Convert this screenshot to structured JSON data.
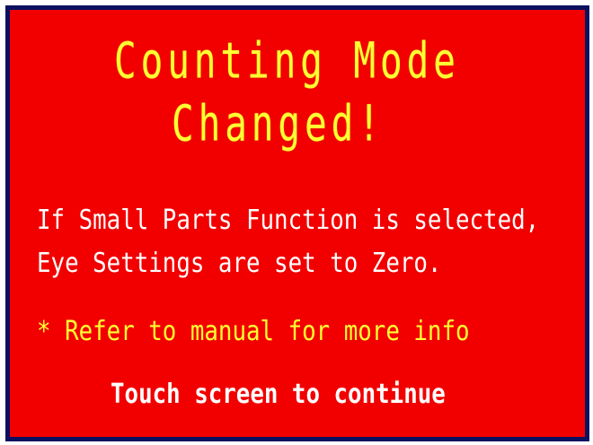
{
  "dialog": {
    "title_line1": "Counting Mode",
    "title_line2": "Changed!",
    "message_line1": "If Small Parts Function is selected,",
    "message_line2": "Eye Settings are set to Zero.",
    "note": "* Refer to manual for more info",
    "prompt": "Touch screen to continue"
  },
  "colors": {
    "background": "#f20000",
    "border": "#0b1060",
    "title": "#ffff33",
    "text": "#ffffff",
    "note": "#ffff33"
  }
}
